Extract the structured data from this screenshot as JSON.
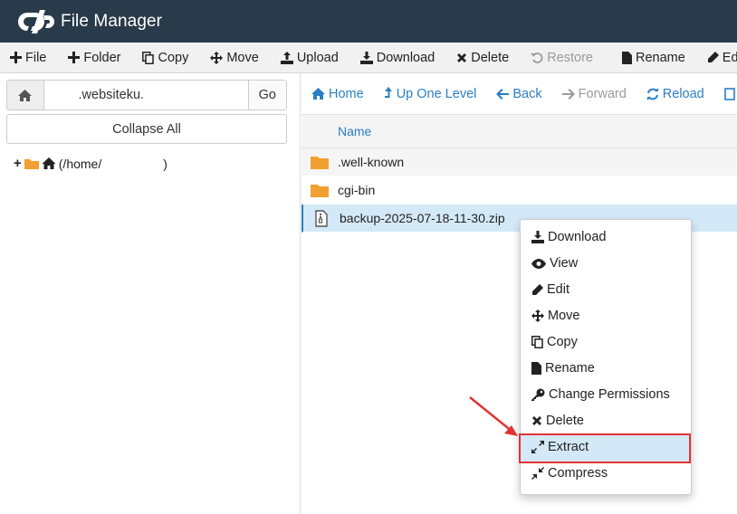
{
  "header": {
    "title": "File Manager",
    "logo_icon": "cpanel-logo-icon"
  },
  "toolbar": {
    "items": [
      {
        "label": "File",
        "icon": "plus-icon"
      },
      {
        "label": "Folder",
        "icon": "plus-icon"
      },
      {
        "label": "Copy",
        "icon": "copy-icon"
      },
      {
        "label": "Move",
        "icon": "move-icon"
      },
      {
        "label": "Upload",
        "icon": "upload-icon"
      },
      {
        "label": "Download",
        "icon": "download-icon"
      },
      {
        "label": "Delete",
        "icon": "close-icon"
      },
      {
        "label": "Restore",
        "icon": "undo-icon",
        "disabled": true
      },
      {
        "label": "Rename",
        "icon": "file-icon"
      },
      {
        "label": "Edit",
        "icon": "pencil-icon"
      }
    ]
  },
  "pathbar": {
    "value": ".websiteku.",
    "go_label": "Go"
  },
  "left": {
    "collapse_label": "Collapse All",
    "tree_root_label": "(/home/",
    "tree_root_suffix": ")"
  },
  "nav": {
    "items": [
      {
        "label": "Home",
        "icon": "home-icon"
      },
      {
        "label": "Up One Level",
        "icon": "level-up-icon"
      },
      {
        "label": "Back",
        "icon": "arrow-left-icon"
      },
      {
        "label": "Forward",
        "icon": "arrow-right-icon",
        "disabled": true
      },
      {
        "label": "Reload",
        "icon": "reload-icon"
      }
    ]
  },
  "table": {
    "header": "Name",
    "rows": [
      {
        "name": ".well-known",
        "icon": "folder-icon"
      },
      {
        "name": "cgi-bin",
        "icon": "folder-icon"
      },
      {
        "name": "backup-2025-07-18-11-30.zip",
        "icon": "zip-file-icon",
        "selected": true
      }
    ]
  },
  "context_menu": {
    "items": [
      {
        "label": "Download",
        "icon": "download-icon"
      },
      {
        "label": "View",
        "icon": "eye-icon"
      },
      {
        "label": "Edit",
        "icon": "pencil-icon"
      },
      {
        "label": "Move",
        "icon": "move-icon"
      },
      {
        "label": "Copy",
        "icon": "copy-icon"
      },
      {
        "label": "Rename",
        "icon": "file-icon"
      },
      {
        "label": "Change Permissions",
        "icon": "key-icon"
      },
      {
        "label": "Delete",
        "icon": "close-icon"
      },
      {
        "label": "Extract",
        "icon": "expand-icon",
        "highlighted": true
      },
      {
        "label": "Compress",
        "icon": "compress-icon"
      }
    ]
  },
  "colors": {
    "header_bg": "#293a4a",
    "link": "#2a7fc4",
    "highlight_border": "#e03434",
    "selection_bg": "#d4e9f7",
    "folder": "#f0a030"
  }
}
